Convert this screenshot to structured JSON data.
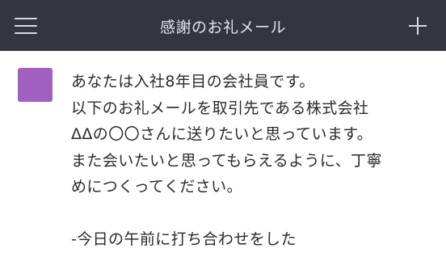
{
  "header": {
    "title": "感謝のお礼メール",
    "menu_icon": "hamburger-menu-icon",
    "add_icon": "plus-icon"
  },
  "colors": {
    "header_bg": "#343540",
    "avatar": "#a05fc1",
    "text": "#2a2a2a"
  },
  "message": {
    "lines": [
      "あなたは入社8年目の会社員です。",
      "以下のお礼メールを取引先である株式会社",
      "ΔΔの〇〇さんに送りたいと思っています。",
      "また会いたいと思ってもらえるように、丁寧",
      "めにつくってください。",
      "",
      "-今日の午前に打ち合わせをした"
    ]
  }
}
